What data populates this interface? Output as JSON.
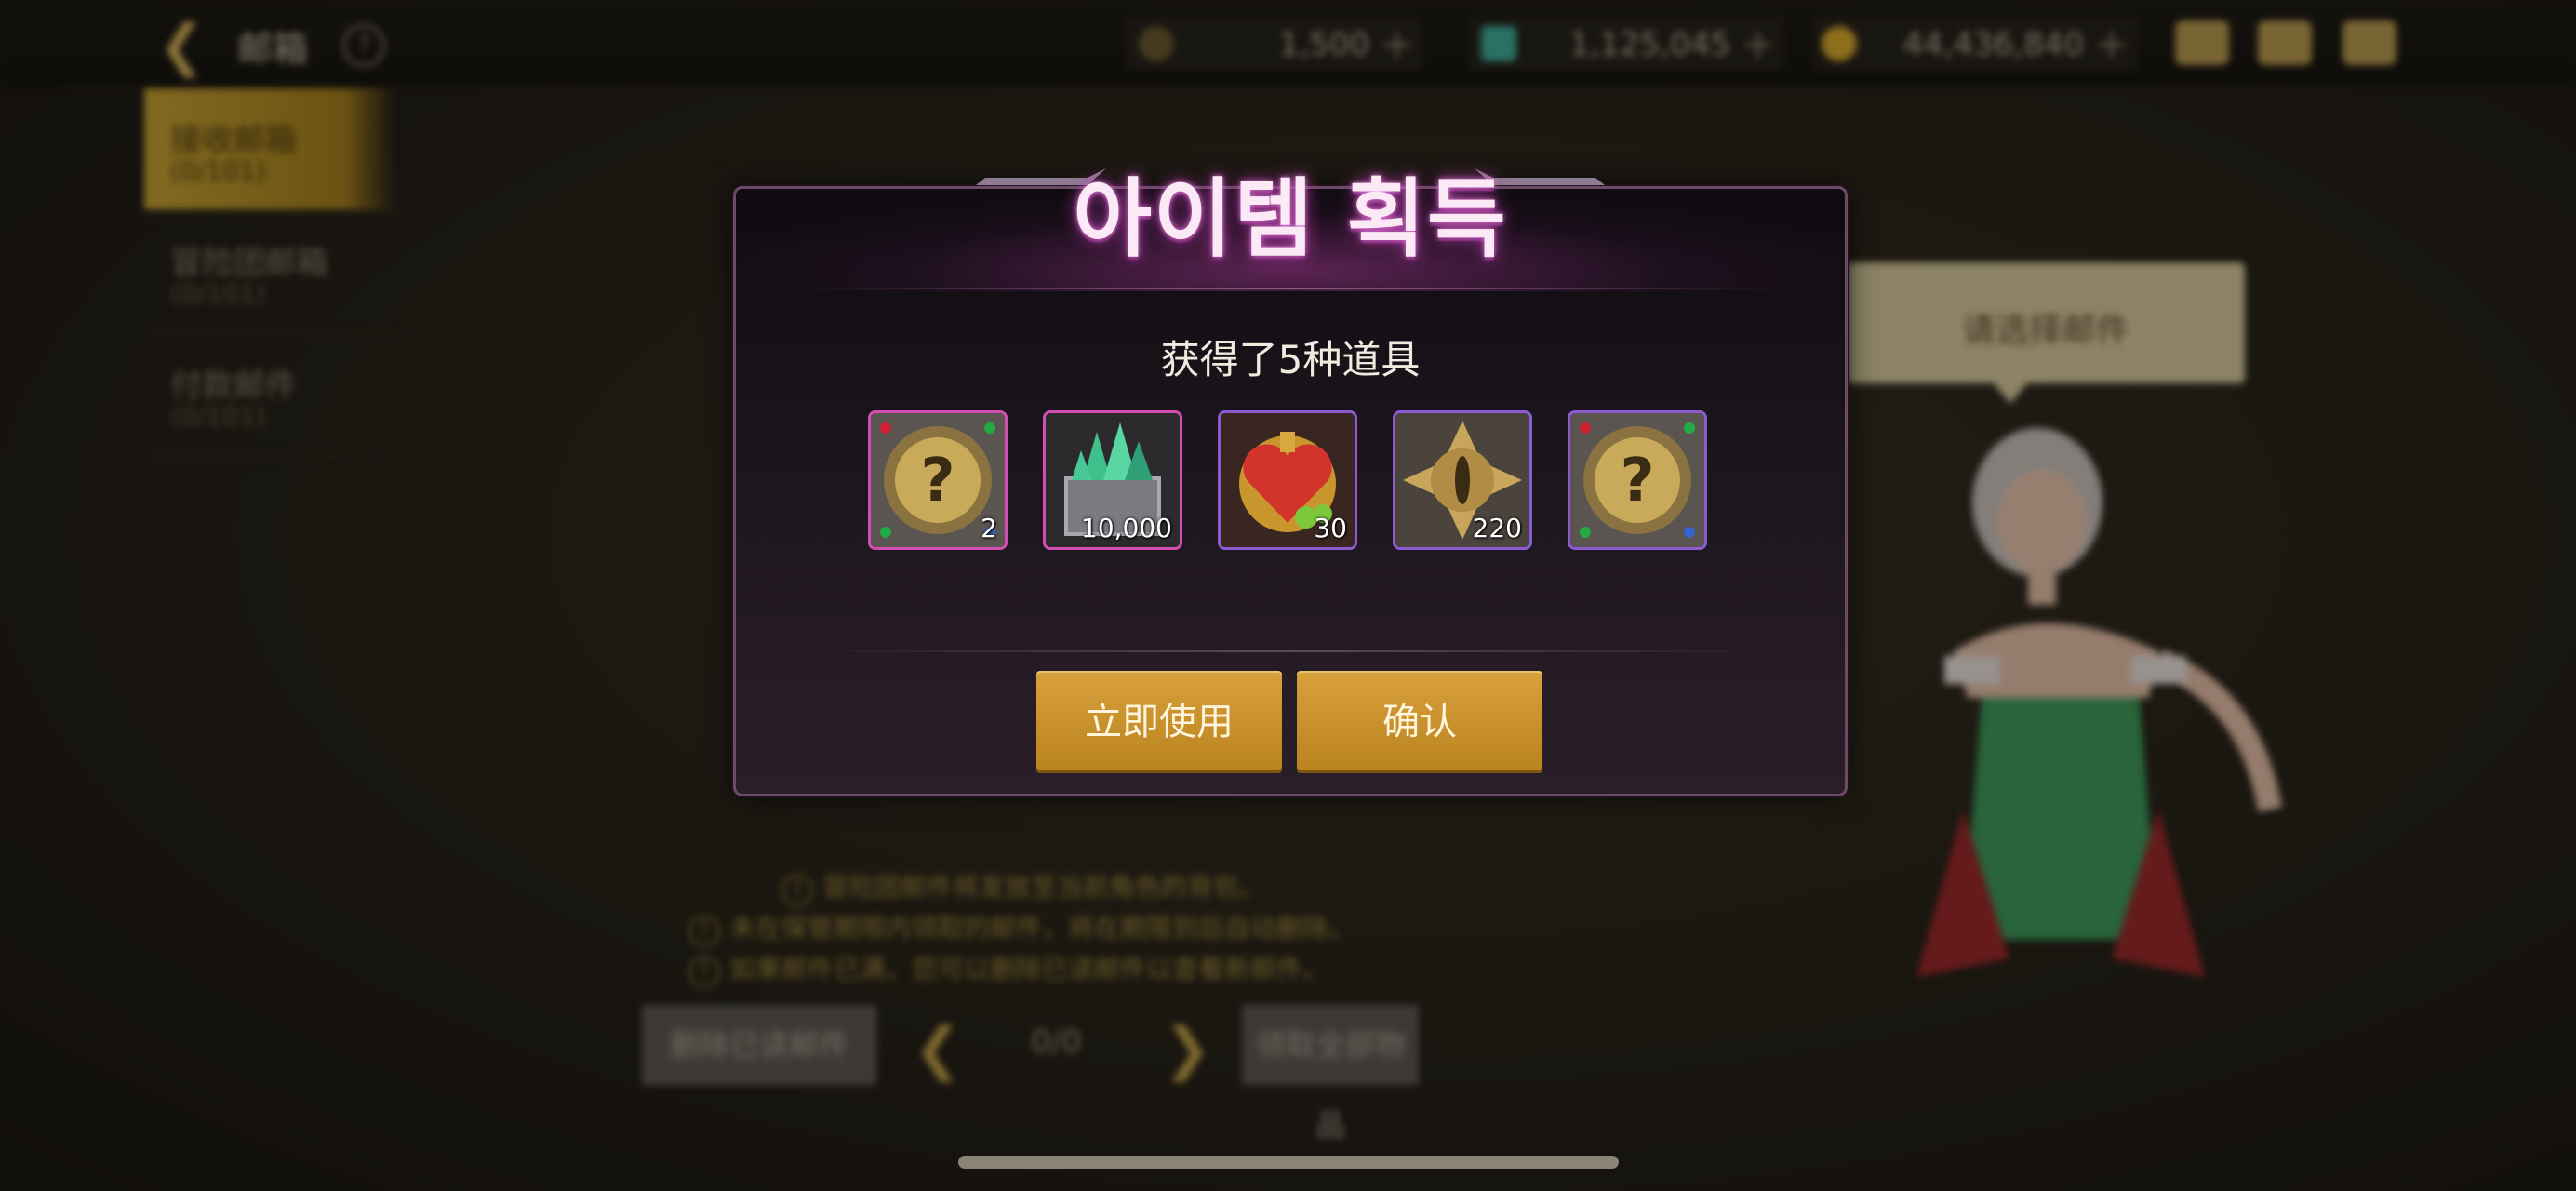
{
  "topbar": {
    "back_icon": "back-arrow-icon",
    "title": "邮箱",
    "help_icon": "question-icon",
    "currencies": [
      {
        "icon": "coin-c-icon",
        "value": "1,500",
        "color": "#c9a24a"
      },
      {
        "icon": "crystal-icon",
        "value": "1,125,045",
        "color": "#3fae9a"
      },
      {
        "icon": "gold-icon",
        "value": "44,436,840",
        "color": "#d9a92c"
      }
    ],
    "right_icons": [
      "bag-icon",
      "mail-icon",
      "chat-icon"
    ]
  },
  "sidebar": {
    "items": [
      {
        "label": "接收邮箱",
        "count": "(0/101)",
        "active": true
      },
      {
        "label": "冒险团邮箱",
        "count": "(0/101)",
        "active": false
      },
      {
        "label": "付款邮件",
        "count": "(0/101)",
        "active": false
      }
    ]
  },
  "hint": {
    "text": "请选择邮件"
  },
  "notes": [
    "冒险团邮件将发放至当前角色的背包。",
    "未在保管期限内领取的邮件，将在期限到后自动删除。",
    "如果邮件已满，您可以删除已读邮件以查看新邮件。"
  ],
  "bottom": {
    "delete_label": "删除已读邮件",
    "pager": "0/0",
    "claim_label": "领取全部物品"
  },
  "modal": {
    "title": "아이템 획득",
    "message": "获得了5种道具",
    "items": [
      {
        "icon": "mystery-box-icon",
        "count": "2",
        "rarity": "pink"
      },
      {
        "icon": "crystal-chest-icon",
        "count": "10,000",
        "rarity": "pink"
      },
      {
        "icon": "heart-potion-icon",
        "count": "30",
        "rarity": "purple"
      },
      {
        "icon": "eye-emblem-icon",
        "count": "220",
        "rarity": "purple"
      },
      {
        "icon": "mystery-box-icon",
        "count": "",
        "rarity": "purple"
      }
    ],
    "use_now_label": "立即使用",
    "confirm_label": "确认"
  },
  "colors": {
    "accent_gold": "#c9952c",
    "title_glow": "#d05ac6",
    "rarity_pink": "#d24fb2",
    "rarity_purple": "#8c5bd2"
  }
}
